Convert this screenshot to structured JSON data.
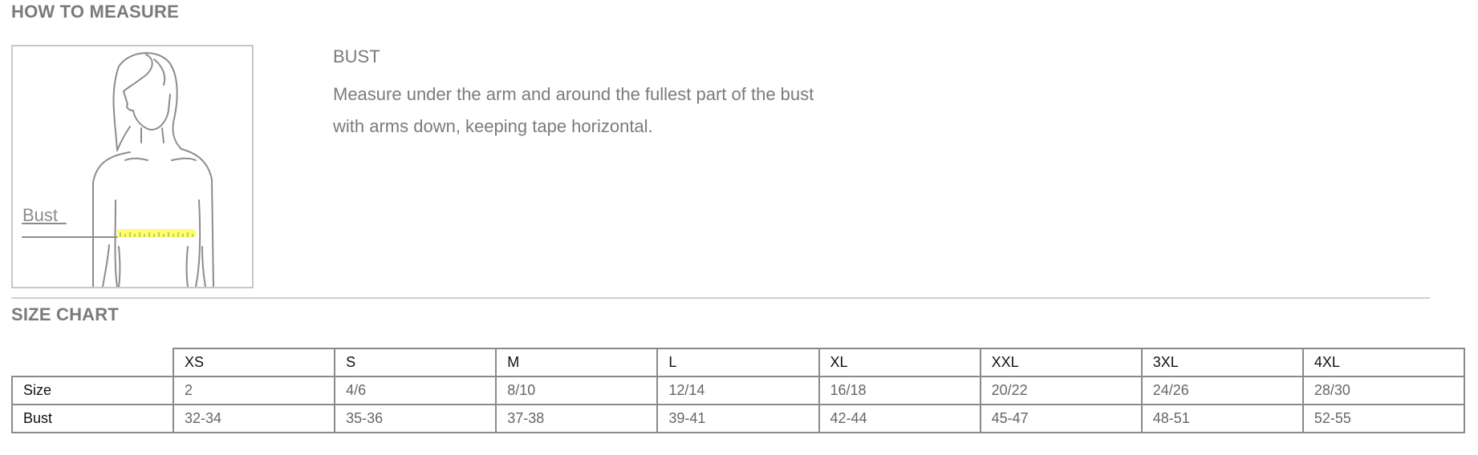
{
  "how_to_measure": {
    "title": "HOW TO MEASURE",
    "figure": {
      "label": "Bust",
      "icon": "female-torso-bust-diagram",
      "tape_color": "#ffff66"
    },
    "heading": "BUST",
    "description": "Measure under the arm and around the fullest part of the bust with arms down, keeping tape horizontal."
  },
  "size_chart": {
    "title": "SIZE CHART",
    "columns": [
      "XS",
      "S",
      "M",
      "L",
      "XL",
      "XXL",
      "3XL",
      "4XL"
    ],
    "rows": [
      {
        "label": "Size",
        "values": [
          "2",
          "4/6",
          "8/10",
          "12/14",
          "16/18",
          "20/22",
          "24/26",
          "28/30"
        ]
      },
      {
        "label": "Bust",
        "values": [
          "32-34",
          "35-36",
          "37-38",
          "39-41",
          "42-44",
          "45-47",
          "48-51",
          "52-55"
        ]
      }
    ]
  }
}
